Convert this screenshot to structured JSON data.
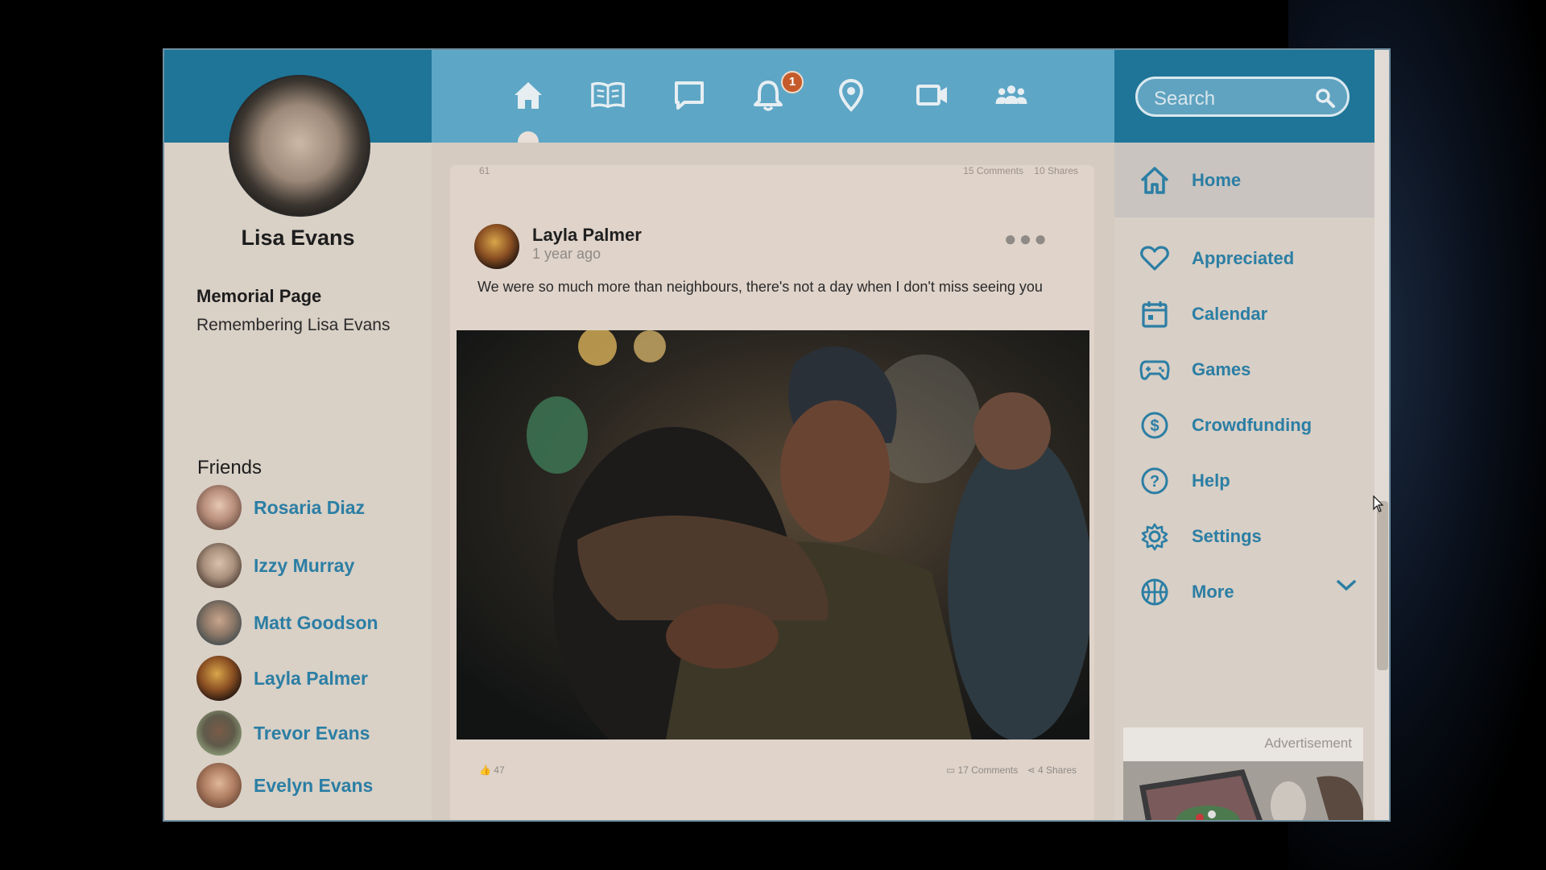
{
  "profile": {
    "name": "Lisa Evans",
    "page_type": "Memorial Page",
    "page_subtitle": "Remembering Lisa Evans"
  },
  "friends": {
    "title": "Friends",
    "items": [
      {
        "name": "Rosaria Diaz"
      },
      {
        "name": "Izzy Murray"
      },
      {
        "name": "Matt Goodson"
      },
      {
        "name": "Layla Palmer"
      },
      {
        "name": "Trevor Evans"
      },
      {
        "name": "Evelyn Evans"
      }
    ]
  },
  "topnav": {
    "icons": [
      "home-icon",
      "book-icon",
      "chat-icon",
      "bell-icon",
      "location-pin-icon",
      "video-icon",
      "group-icon"
    ],
    "notification_count": "1"
  },
  "search": {
    "placeholder": "Search"
  },
  "feed": {
    "previous_post": {
      "likes": "61",
      "comments": "15 Comments",
      "shares": "10 Shares"
    },
    "post": {
      "author": "Layla Palmer",
      "time": "1 year ago",
      "text": " We were so much more than neighbours, there's not a day when I don't miss seeing you",
      "likes": "47",
      "comments": "17 Comments",
      "shares": "4 Shares"
    }
  },
  "sidebar": {
    "items": [
      {
        "label": "Home",
        "icon": "home-icon"
      },
      {
        "label": "Appreciated",
        "icon": "heart-icon"
      },
      {
        "label": "Calendar",
        "icon": "calendar-icon"
      },
      {
        "label": "Games",
        "icon": "gamepad-icon"
      },
      {
        "label": "Crowdfunding",
        "icon": "dollar-icon"
      },
      {
        "label": "Help",
        "icon": "help-icon"
      },
      {
        "label": "Settings",
        "icon": "gear-icon"
      },
      {
        "label": "More",
        "icon": "basketball-icon"
      }
    ]
  },
  "ad": {
    "label": "Advertisement"
  },
  "colors": {
    "accent": "#2b7ea4",
    "header": "#1e7597",
    "nav": "#5da6c6",
    "badge": "#c55a2a"
  }
}
